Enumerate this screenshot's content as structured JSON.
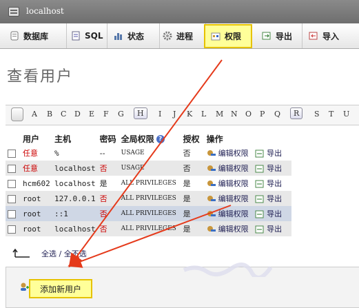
{
  "window": {
    "title": "localhost"
  },
  "tabs": [
    {
      "label": "数据库"
    },
    {
      "label": "SQL"
    },
    {
      "label": "状态"
    },
    {
      "label": "进程"
    },
    {
      "label": "权限"
    },
    {
      "label": "导出"
    },
    {
      "label": "导入"
    }
  ],
  "page_title": "查看用户",
  "alphabet": [
    "A",
    "B",
    "C",
    "D",
    "E",
    "F",
    "G",
    "H",
    "I",
    "J",
    "K",
    "L",
    "M",
    "N",
    "O",
    "P",
    "Q",
    "R",
    "S",
    "T",
    "U"
  ],
  "table": {
    "headers": {
      "user": "用户",
      "host": "主机",
      "password": "密码",
      "global_priv": "全局权限",
      "grant": "授权",
      "action": "操作"
    },
    "rows": [
      {
        "user": "任意",
        "host": "%",
        "password": "--",
        "priv": "USAGE",
        "grant": "否",
        "edit": "编辑权限",
        "export": "导出"
      },
      {
        "user": "任意",
        "host": "localhost",
        "password": "否",
        "priv": "USAGE",
        "grant": "否",
        "edit": "编辑权限",
        "export": "导出"
      },
      {
        "user": "hcm602",
        "host": "localhost",
        "password": "是",
        "priv": "ALL PRIVILEGES",
        "grant": "是",
        "edit": "编辑权限",
        "export": "导出"
      },
      {
        "user": "root",
        "host": "127.0.0.1",
        "password": "否",
        "priv": "ALL PRIVILEGES",
        "grant": "是",
        "edit": "编辑权限",
        "export": "导出"
      },
      {
        "user": "root",
        "host": "::1",
        "password": "否",
        "priv": "ALL PRIVILEGES",
        "grant": "是",
        "edit": "编辑权限",
        "export": "导出"
      },
      {
        "user": "root",
        "host": "localhost",
        "password": "否",
        "priv": "ALL PRIVILEGES",
        "grant": "是",
        "edit": "编辑权限",
        "export": "导出"
      }
    ]
  },
  "select_all": "全选",
  "separator": "/",
  "deselect_all": "全不选",
  "add_user": "添加新用户",
  "colors": {
    "highlight": "#ffff99",
    "arrow": "#e53a1b",
    "red_text": "#cc0000"
  }
}
